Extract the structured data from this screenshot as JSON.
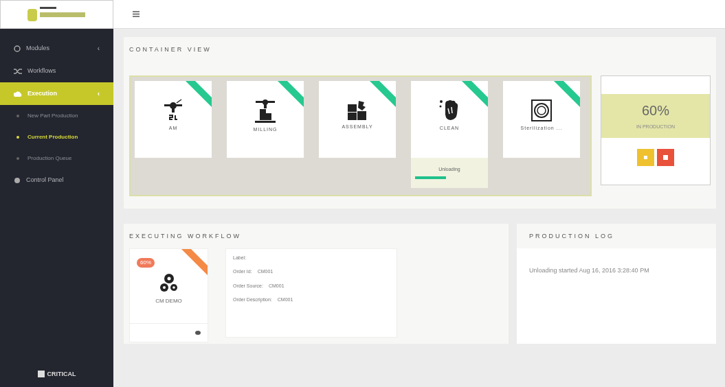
{
  "sidebar": {
    "items": [
      {
        "label": "Modules",
        "kind": "circle",
        "selected": false,
        "caret": "‹"
      },
      {
        "label": "Workflows",
        "kind": "shuffle",
        "selected": false
      },
      {
        "label": "Execution",
        "kind": "play",
        "selected": true,
        "caret": "‹",
        "children": [
          {
            "label": "New Part Production",
            "selected": false
          },
          {
            "label": "Current Production",
            "selected": true
          },
          {
            "label": "Production Queue",
            "selected": false
          }
        ]
      },
      {
        "label": "Control Panel",
        "kind": "dot",
        "selected": false
      }
    ],
    "footer": "CRITICAL"
  },
  "container_view": {
    "title": "CONTAINER VIEW",
    "stations": [
      {
        "name": "AM",
        "kind": "printer"
      },
      {
        "name": "MILLING",
        "kind": "mill"
      },
      {
        "name": "ASSEMBLY",
        "kind": "assembly"
      },
      {
        "name": "CLEAN",
        "kind": "clean",
        "status": "Unloading",
        "level": 0.45
      },
      {
        "name": "Sterilization ...",
        "kind": "steril"
      }
    ],
    "summary": {
      "value": "60%",
      "caption": "IN PRODUCTION"
    }
  },
  "executing_workflow": {
    "title": "EXECUTING WORKFLOW",
    "card": {
      "badge": "60%",
      "name": "CM DEMO"
    },
    "details": [
      {
        "label": "Label:"
      },
      {
        "label": "Order Id:",
        "value": "CM001"
      },
      {
        "label": "Order Source:",
        "value": "CM001"
      },
      {
        "label": "Order Description:",
        "value": "CM001"
      }
    ]
  },
  "production_log": {
    "title": "PRODUCTION LOG",
    "entries": [
      "Unloading started Aug 16, 2016 3:28:40 PM"
    ]
  }
}
